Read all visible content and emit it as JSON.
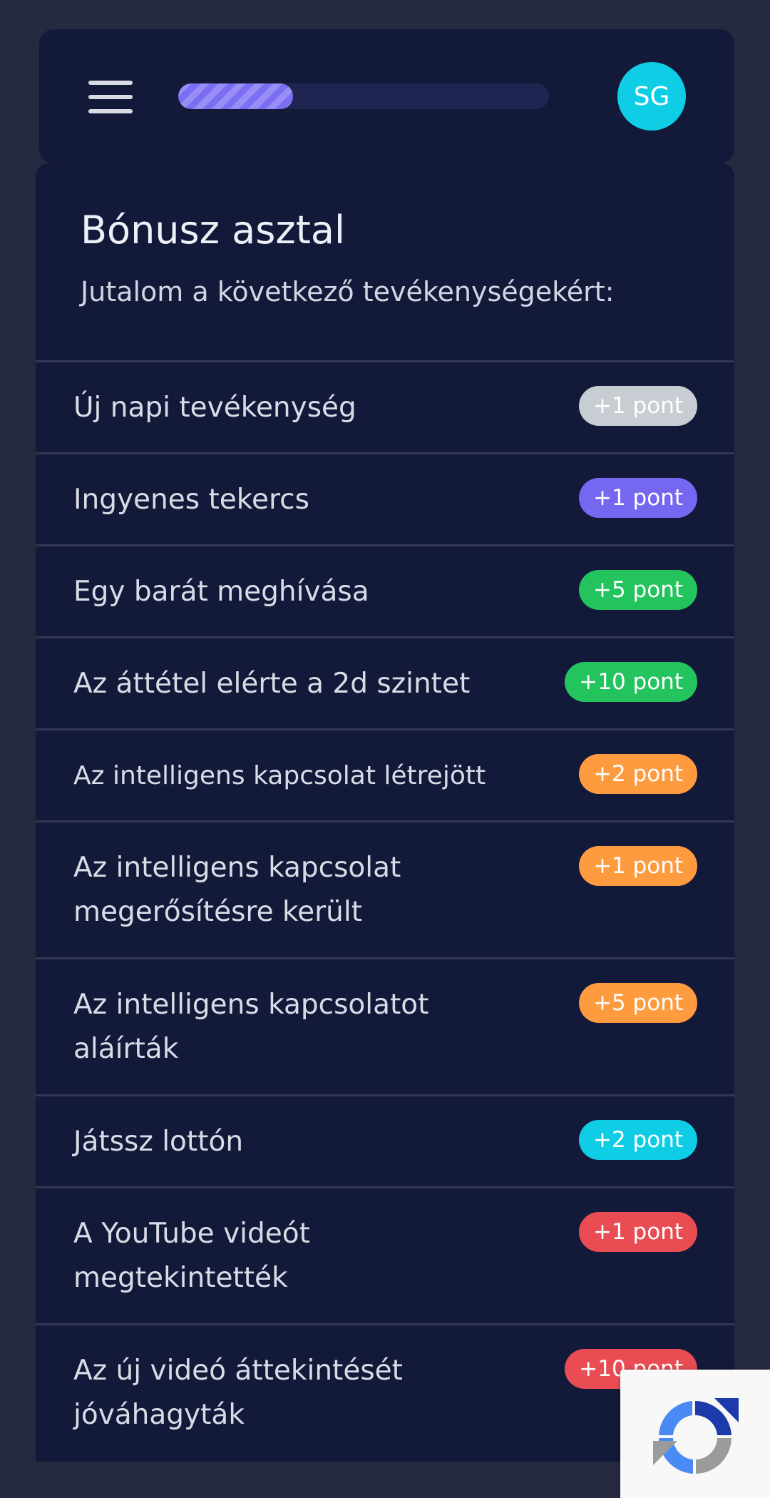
{
  "header": {
    "menu_icon": "hamburger-menu-icon",
    "progress_fraction": 0.31,
    "avatar_initials": "SG"
  },
  "main": {
    "title": "Bónusz asztal",
    "subtitle": "Jutalom a következő tevékenységekért:",
    "rewards": [
      {
        "label": "Új napi tevékenység",
        "points": "+1 pont",
        "color": "#c8ccd3"
      },
      {
        "label": "Ingyenes tekercs",
        "points": "+1 pont",
        "color": "#7567f0"
      },
      {
        "label": "Egy barát meghívása",
        "points": "+5 pont",
        "color": "#23c35e"
      },
      {
        "label": "Az áttétel elérte a 2d szintet",
        "points": "+10 pont",
        "color": "#23c35e"
      },
      {
        "label": "Az intelligens kapcsolat létrejött",
        "points": "+2 pont",
        "color": "#ff9b3f"
      },
      {
        "label": "Az intelligens kapcsolat\nmegerősítésre került",
        "points": "+1 pont",
        "color": "#ff9b3f"
      },
      {
        "label": "Az intelligens kapcsolatot\naláírták",
        "points": "+5 pont",
        "color": "#ff9b3f"
      },
      {
        "label": "Játssz lottón",
        "points": "+2 pont",
        "color": "#10cde6"
      },
      {
        "label": "A YouTube videót\nmegtekintették",
        "points": "+1 pont",
        "color": "#e94d53"
      },
      {
        "label": "Az új videó áttekintését\njóváhagyták",
        "points": "+10 pont",
        "color": "#e94d53"
      }
    ]
  },
  "overlay": {
    "recaptcha_icon": "recaptcha-icon"
  }
}
